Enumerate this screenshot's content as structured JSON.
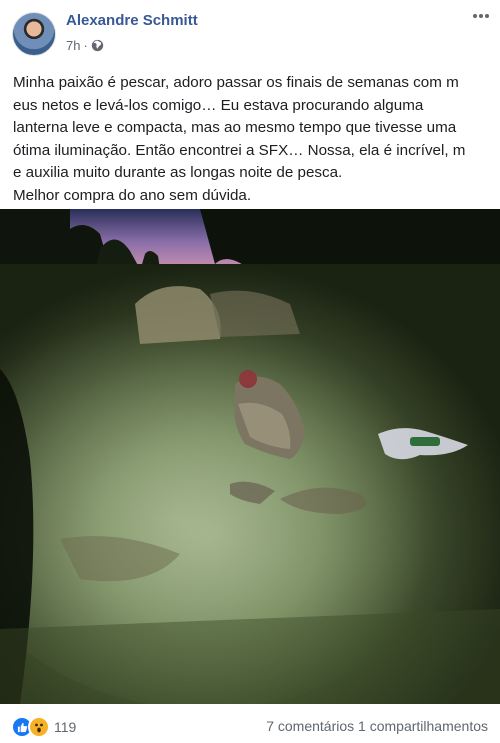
{
  "post": {
    "author": "Alexandre Schmitt",
    "time": "7h",
    "separator": "·",
    "privacy_icon": "globe-icon",
    "more_icon": "more-options-icon",
    "text": "Minha paixão é pescar, adoro passar os finais de semanas com m\neus netos e levá-los comigo… Eu estava procurando alguma\nlanterna leve e compacta, mas ao mesmo tempo que tivesse uma\nótima iluminação. Então encontrei a SFX… Nossa, ela é incrível, m\ne auxilia muito durante as longas noite de pesca.\nMelhor compra do ano sem dúvida."
  },
  "reactions": {
    "icons": [
      "like-icon",
      "wow-icon"
    ],
    "count": "119"
  },
  "engagement": {
    "comments": "7 comentários",
    "shares": "1 compartilhamentos"
  },
  "colors": {
    "author_link": "#385898",
    "secondary_text": "#606770",
    "like_blue": "#1877f2",
    "wow_yellow": "#f7b125"
  }
}
